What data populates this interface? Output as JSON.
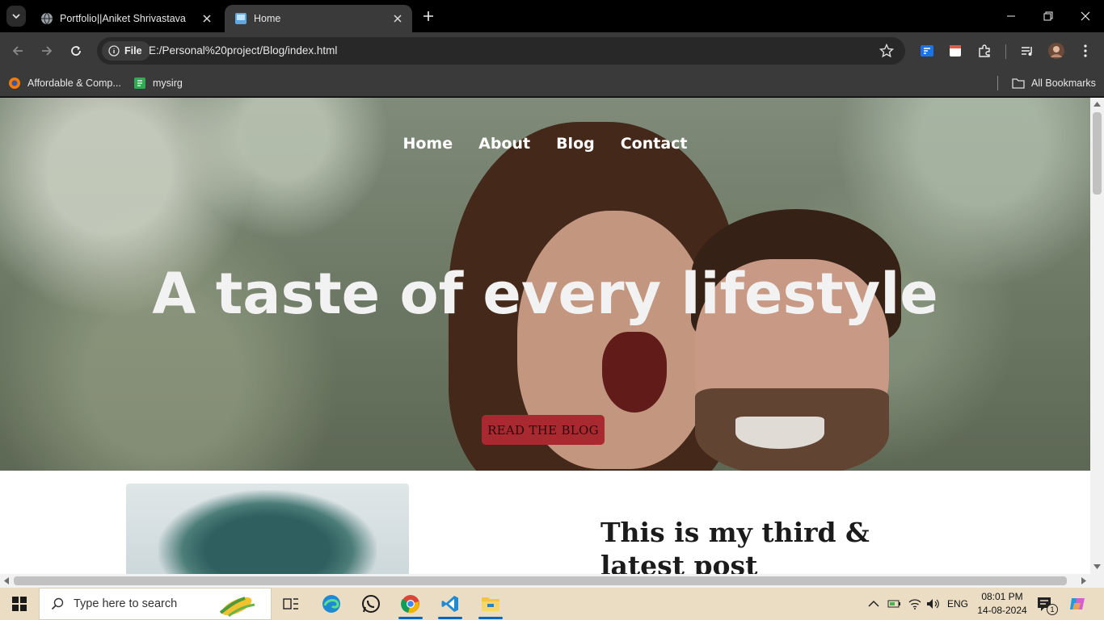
{
  "tabs": [
    {
      "title": "Portfolio||Aniket Shrivastava"
    },
    {
      "title": "Home"
    }
  ],
  "omnibox": {
    "chip": "File",
    "url": "E:/Personal%20project/Blog/index.html"
  },
  "bookmarks": [
    {
      "label": "Affordable & Comp..."
    },
    {
      "label": "mysirg"
    }
  ],
  "all_bookmarks": "All Bookmarks",
  "page": {
    "nav": [
      "Home",
      "About",
      "Blog",
      "Contact"
    ],
    "hero_title": "A taste of every lifestyle",
    "cta": "READ THE BLOG",
    "post_title": "This is my third & latest post"
  },
  "taskbar": {
    "search_placeholder": "Type here to search",
    "language": "ENG",
    "time": "08:01 PM",
    "date": "14-08-2024",
    "notification_count": "1"
  },
  "colors": {
    "cta_bg": "#a82a30",
    "taskbar_bg": "#eaddc4",
    "chrome_bg": "#3a3a3a"
  }
}
